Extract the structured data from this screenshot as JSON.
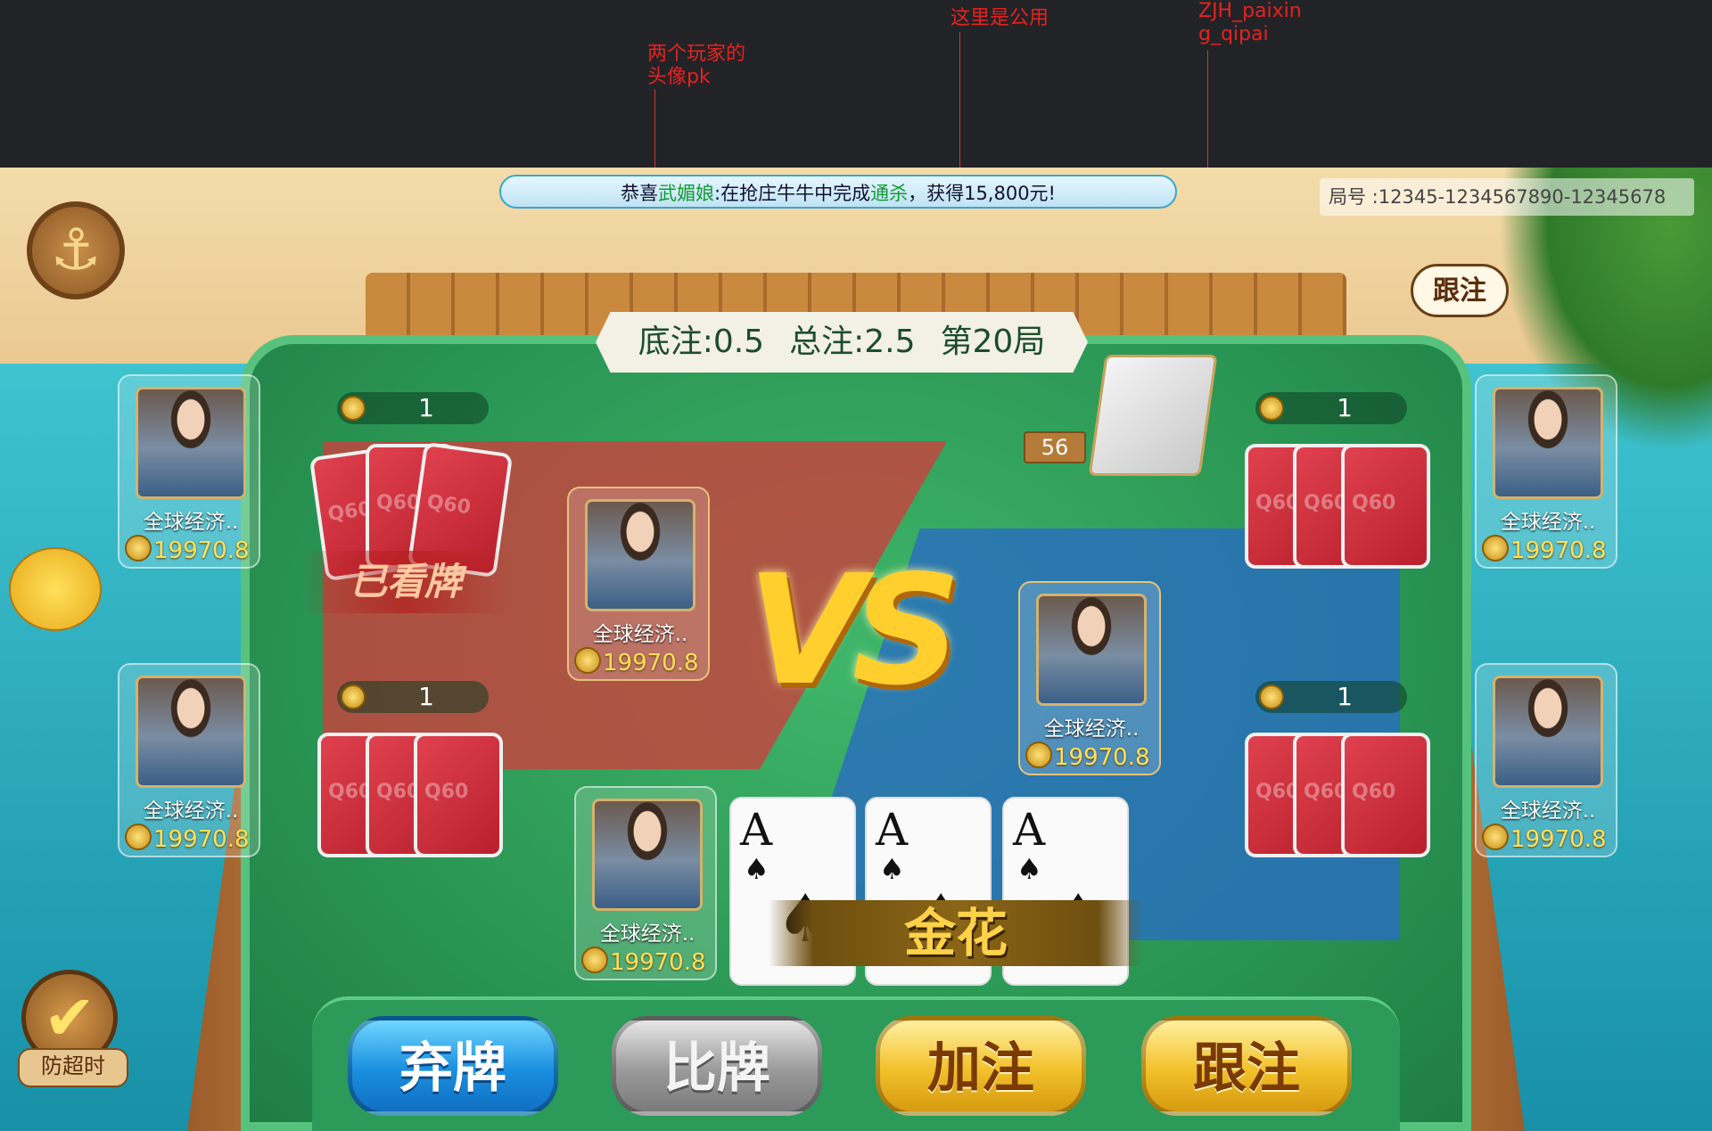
{
  "annotations": [
    {
      "text": "两个玩家的\n头像pk"
    },
    {
      "text": "这里是公用"
    },
    {
      "text": "ZJH_paixin\ng_qipai"
    }
  ],
  "ticker": {
    "prefix": "恭喜",
    "player": "武媚娘",
    "middle": ":在抢庄牛牛中完成",
    "event": "通杀",
    "suffix": "，获得15,800元!"
  },
  "room_id": "局号 :12345-1234567890-12345678",
  "table_info": {
    "base_bet": "底注:0.5",
    "total_bet": "总注:2.5",
    "round": "第20局"
  },
  "deck_count": "56",
  "bubble": "跟注",
  "players": {
    "left_top": {
      "name": "全球经济..",
      "coins": "19970.8",
      "bet": "1"
    },
    "left_bottom": {
      "name": "全球经济..",
      "coins": "19970.8",
      "bet": "1"
    },
    "right_top": {
      "name": "全球经济..",
      "coins": "19970.8",
      "bet": "1"
    },
    "right_bottom": {
      "name": "全球经济..",
      "coins": "19970.8",
      "bet": "1"
    },
    "vs_left": {
      "name": "全球经济..",
      "coins": "19970.8"
    },
    "vs_right": {
      "name": "全球经济..",
      "coins": "19970.8"
    },
    "self": {
      "name": "全球经济..",
      "coins": "19970.8"
    }
  },
  "seen_label": "已看牌",
  "vs_text": "VS",
  "self_hand": {
    "cards": [
      {
        "rank": "A",
        "suit": "♠"
      },
      {
        "rank": "A",
        "suit": "♠"
      },
      {
        "rank": "A",
        "suit": "♠"
      }
    ],
    "type": "金花"
  },
  "buttons": {
    "fold": "弃牌",
    "compare": "比牌",
    "raise": "加注",
    "call": "跟注"
  },
  "timeout": {
    "label": "防超时",
    "icon": "checkmark-icon"
  },
  "icons": {
    "anchor": "anchor-icon",
    "coin": "coin-icon",
    "pufferfish": "pufferfish-icon"
  },
  "colors": {
    "table_green": "#2a9654",
    "vs_red": "#d03e3c",
    "vs_blue": "#286ebe",
    "gold": "#ffcf2e"
  }
}
